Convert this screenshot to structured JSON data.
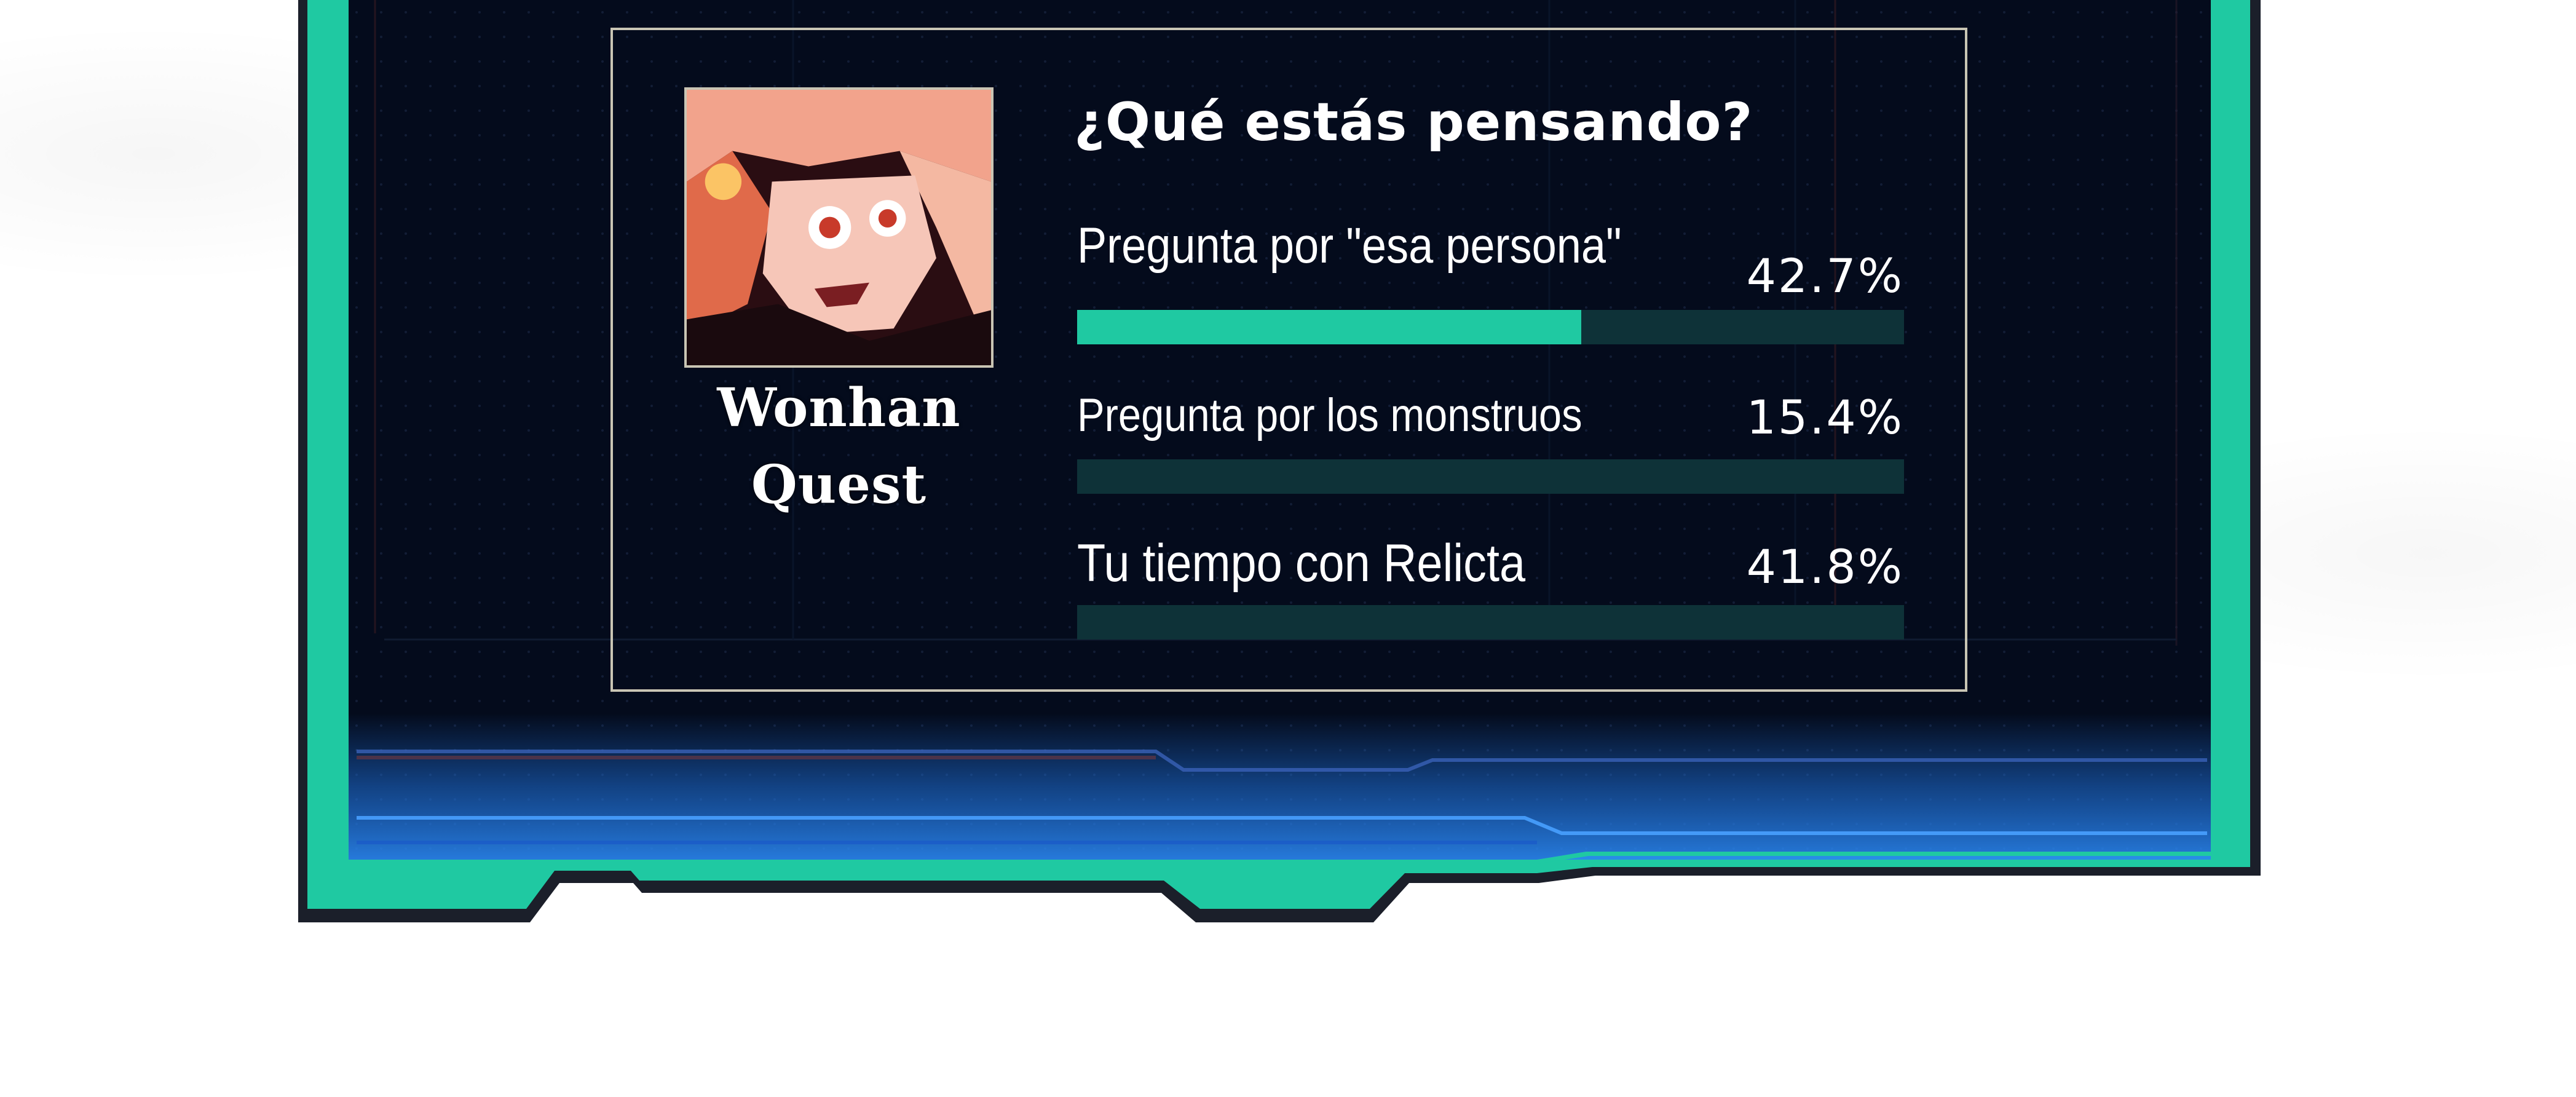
{
  "poll": {
    "author": {
      "line1": "Wonhan",
      "line2": "Quest",
      "avatar_icon": "manga-character-avatar"
    },
    "question": "¿Qué estás pensando?",
    "options": [
      {
        "label": "Pregunta por \"esa persona\"",
        "percent_text": "42.7%",
        "value": 42.7
      },
      {
        "label": "Pregunta por los monstruos",
        "percent_text": "15.4%",
        "value": 15.4
      },
      {
        "label": "Tu tiempo con Relicta",
        "percent_text": "41.8%",
        "value": 41.8
      }
    ]
  },
  "colors": {
    "frame_accent": "#1fc9a2",
    "frame_outline": "#1b1f2a",
    "panel_background": "#040b1c",
    "bar_fill": "#1fc9a2",
    "bar_track": "#0e3238",
    "panel_border": "#c9c5b4",
    "glow_blue": "#1e6fd8"
  }
}
